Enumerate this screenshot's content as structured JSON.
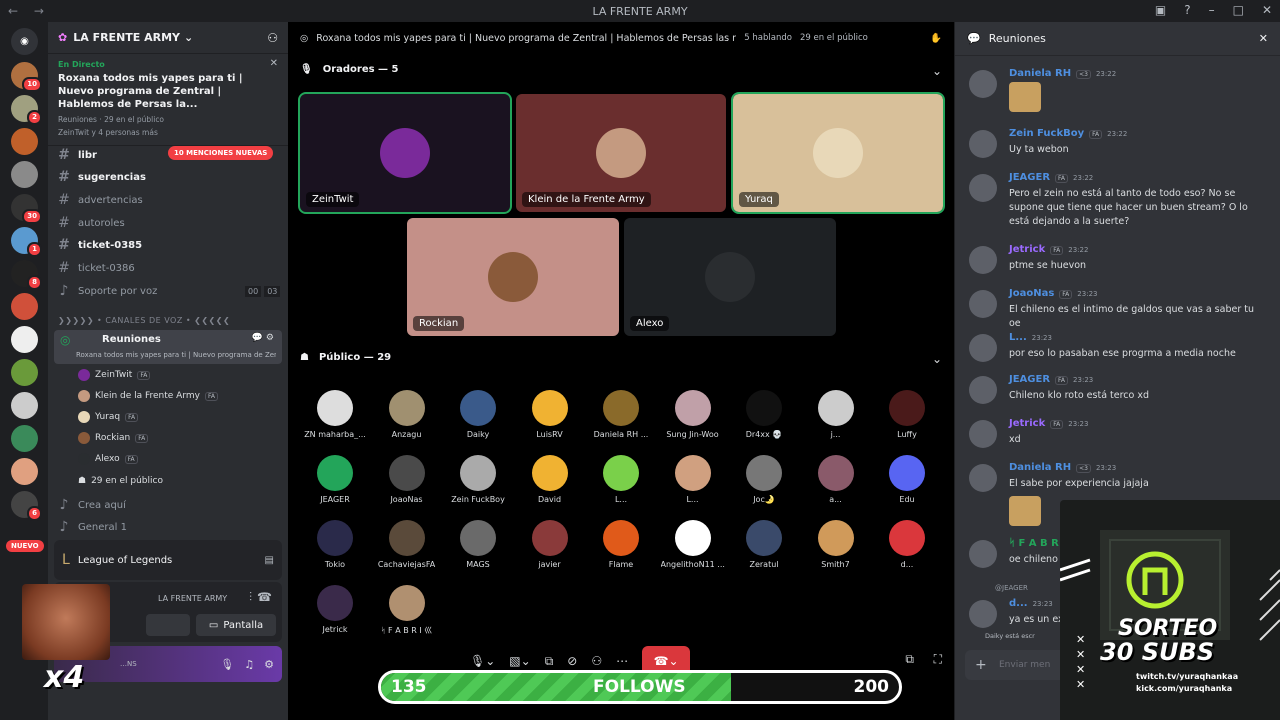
{
  "window": {
    "title": "LA FRENTE ARMY"
  },
  "servers": [
    {
      "badge": "10"
    },
    {
      "badge": "2"
    },
    {
      "badge": ""
    },
    {
      "badge": ""
    },
    {
      "badge": "30"
    },
    {
      "badge": "1"
    },
    {
      "badge": "8"
    },
    {
      "badge": ""
    },
    {
      "badge": ""
    },
    {
      "badge": ""
    },
    {
      "badge": ""
    },
    {
      "badge": ""
    },
    {
      "badge": ""
    },
    {
      "badge": "6"
    }
  ],
  "new_badge": "NUEVO",
  "guild": {
    "name": "LA FRENTE ARMY"
  },
  "live": {
    "tag": "En Directo",
    "title": "Roxana todos mis yapes para ti | Nuevo programa de Zentral | Hablemos de Persas la...",
    "channel": "Reuniones",
    "audience": "29 en el público",
    "people": "ZeinTwit y 4 personas más"
  },
  "mention_badge": "10 MENCIONES NUEVAS",
  "channels": [
    {
      "name": "libr",
      "icon": "#",
      "unread": true
    },
    {
      "name": "sugerencias",
      "icon": "#",
      "unread": true
    },
    {
      "name": "advertencias",
      "icon": "#",
      "unread": false
    },
    {
      "name": "autoroles",
      "icon": "#",
      "unread": false
    },
    {
      "name": "ticket-0385",
      "icon": "#",
      "unread": true
    },
    {
      "name": "ticket-0386",
      "icon": "#",
      "unread": false
    },
    {
      "name": "Soporte por voz",
      "icon": "♪",
      "unread": false,
      "counts": [
        "00",
        "03"
      ]
    }
  ],
  "voice_category": "❯❯❯❯❯ • CANALES DE VOZ • ❮❮❮❮❮",
  "stage": {
    "name": "Reuniones",
    "desc": "Roxana todos mis yapes para ti | Nuevo programa de Zen..."
  },
  "voice_users": [
    {
      "name": "ZeinTwit",
      "tag": "FA"
    },
    {
      "name": "Klein de la Frente Army",
      "tag": "FA"
    },
    {
      "name": "Yuraq",
      "tag": "FA"
    },
    {
      "name": "Rockian",
      "tag": "FA"
    },
    {
      "name": "Alexo",
      "tag": "FA"
    }
  ],
  "audience_line": "29 en el público",
  "other_voice": [
    {
      "name": "Crea aquí"
    },
    {
      "name": "General 1"
    }
  ],
  "activity": {
    "name": "League of Legends"
  },
  "rtc": {
    "server": "LA FRENTE ARMY",
    "screen_label": "Pantalla"
  },
  "user_partial": "…NS",
  "emote_overlay": "x4",
  "stage_header": {
    "title": "Roxana todos mis yapes para ti | Nuevo programa de Zentral | Hablemos de Persas las más",
    "speaking": "5 hablando",
    "public": "29 en el público"
  },
  "speakers_section": "Oradores — 5",
  "speakers": [
    {
      "name": "ZeinTwit",
      "bg": "#1a1220",
      "av": "#7a2a9a"
    },
    {
      "name": "Klein de la Frente Army",
      "bg": "#6a2e2e",
      "av": "#c49a80"
    },
    {
      "name": "Yuraq",
      "bg": "#d8c09a",
      "av": "#e8d8b8"
    },
    {
      "name": "Rockian",
      "bg": "#c49088",
      "av": "#8a5a3a"
    },
    {
      "name": "Alexo",
      "bg": "#1e2124",
      "av": "#2a2d30"
    }
  ],
  "public_section": "Público — 29",
  "audience": [
    {
      "name": "ZN maharba_...",
      "color": "#ddd"
    },
    {
      "name": "Anzagu",
      "color": "#a09070"
    },
    {
      "name": "Daiky",
      "color": "#3a5a8a"
    },
    {
      "name": "LuisRV",
      "color": "#f0b232"
    },
    {
      "name": "Daniela RH ...",
      "color": "#8a6a2a"
    },
    {
      "name": "Sung Jin-Woo",
      "color": "#c0a0a8"
    },
    {
      "name": "Dr4xx 💀",
      "color": "#111"
    },
    {
      "name": "j...",
      "color": "#ccc"
    },
    {
      "name": "Luffy",
      "color": "#4a1a1a"
    },
    {
      "name": "JEAGER",
      "color": "#23a55a"
    },
    {
      "name": "JoaoNas",
      "color": "#4a4a4a"
    },
    {
      "name": "Zein FuckBoy",
      "color": "#aaa"
    },
    {
      "name": "David",
      "color": "#f0b232"
    },
    {
      "name": "L...",
      "color": "#7ad04a"
    },
    {
      "name": "L...",
      "color": "#d0a080"
    },
    {
      "name": "Joc🌛",
      "color": "#777"
    },
    {
      "name": "a...",
      "color": "#8a5a6a"
    },
    {
      "name": "Edu",
      "color": "#5865f2"
    },
    {
      "name": "Tokio",
      "color": "#2a2a4a"
    },
    {
      "name": "CachaviejasFA",
      "color": "#5a4a3a"
    },
    {
      "name": "MAGS",
      "color": "#6a6a6a"
    },
    {
      "name": "javier",
      "color": "#8a3a3a"
    },
    {
      "name": "Flame",
      "color": "#e05a1a"
    },
    {
      "name": "AngelithoN11 ...",
      "color": "#fff"
    },
    {
      "name": "Zeratul",
      "color": "#3a4a6a"
    },
    {
      "name": "Smith7",
      "color": "#d09a5a"
    },
    {
      "name": "d...",
      "color": "#da373c"
    },
    {
      "name": "Jetrick",
      "color": "#3a2a4a"
    },
    {
      "name": "ᛋ F A B R I 巛",
      "color": "#b09070"
    }
  ],
  "follow_goal": {
    "current": "135",
    "label": "FOLLOWS",
    "target": "200",
    "fraction": 0.675
  },
  "chat": {
    "title": "Reuniones",
    "placeholder": "Enviar men",
    "messages": [
      {
        "name": "Daniela RH",
        "badge": "<3",
        "time": "23:22",
        "text": "",
        "color": "#4e8fe0",
        "image": true
      },
      {
        "name": "Zein FuckBoy",
        "badge": "FA",
        "time": "23:22",
        "text": "Uy ta webon",
        "color": "#4e8fe0"
      },
      {
        "name": "JEAGER",
        "badge": "FA",
        "time": "23:22",
        "text": "Pero el zein no está al tanto de todo eso? No se supone que tiene que hacer un buen stream? O lo está dejando a la suerte?",
        "color": "#4e8fe0"
      },
      {
        "name": "Jetrick",
        "badge": "FA",
        "time": "23:22",
        "text": "ptme se huevon",
        "color": "#9a6aff"
      },
      {
        "name": "JoaoNas",
        "badge": "FA",
        "time": "23:23",
        "text": "El chileno es el intimo de galdos que vas a saber tu oe",
        "color": "#4e8fe0"
      },
      {
        "name": "L...",
        "badge": "",
        "time": "23:23",
        "text": "por eso lo pasaban ese progrma a media noche",
        "color": "#4e8fe0"
      },
      {
        "name": "JEAGER",
        "badge": "FA",
        "time": "23:23",
        "text": "Chileno klo roto está terco xd",
        "color": "#4e8fe0"
      },
      {
        "name": "Jetrick",
        "badge": "FA",
        "time": "23:23",
        "text": "xd",
        "color": "#9a6aff"
      },
      {
        "name": "Daniela RH",
        "badge": "<3",
        "time": "23:23",
        "text": "El sabe por experiencia jajaja",
        "color": "#4e8fe0",
        "image": true
      },
      {
        "name": "ᛋ F A B R",
        "badge": "",
        "time": "",
        "text": "oe chileno l",
        "color": "#23a55a"
      },
      {
        "name": "d...",
        "badge": "",
        "time": "23:23",
        "text": "ya es un exi",
        "color": "#4e8fe0"
      }
    ],
    "reply_to": "@JEAGER",
    "typing": "Daiky está escr"
  },
  "promo": {
    "title": "SORTEO",
    "subtitle": "30 SUBS",
    "twitch": "twitch.tv/yuraqhankaa",
    "kick": "kick.com/yuraqhanka"
  }
}
